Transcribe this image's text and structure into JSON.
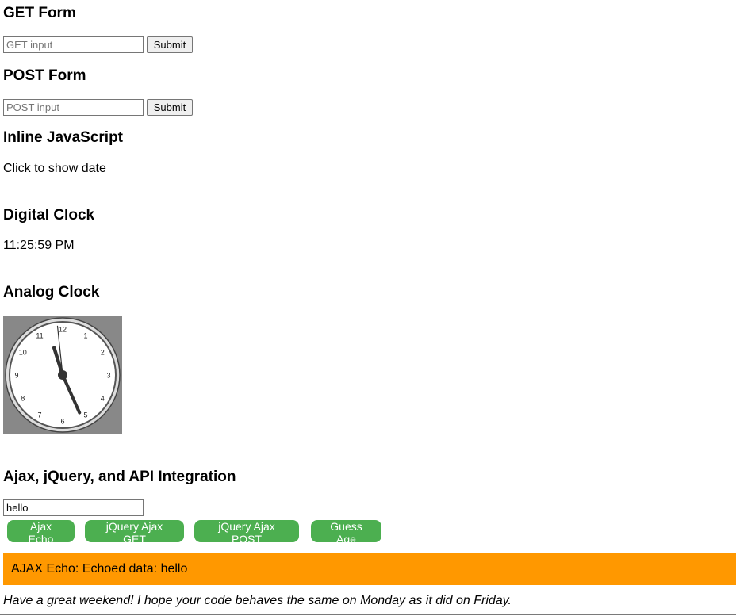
{
  "get_form": {
    "heading": "GET Form",
    "placeholder": "GET input",
    "submit_label": "Submit"
  },
  "post_form": {
    "heading": "POST Form",
    "placeholder": "POST input",
    "submit_label": "Submit"
  },
  "inline_js": {
    "heading": "Inline JavaScript",
    "text": "Click to show date"
  },
  "digital_clock": {
    "heading": "Digital Clock",
    "time": "11:25:59 PM"
  },
  "analog_clock": {
    "heading": "Analog Clock",
    "numbers": [
      "12",
      "1",
      "2",
      "3",
      "4",
      "5",
      "6",
      "7",
      "8",
      "9",
      "10",
      "11"
    ],
    "time": {
      "hours": 11,
      "minutes": 25,
      "seconds": 59
    },
    "colors": {
      "background": "#888888",
      "face": "#ffffff",
      "hands": "#333333"
    }
  },
  "ajax": {
    "heading": "Ajax, jQuery, and API Integration",
    "input_value": "hello",
    "buttons": [
      "Ajax Echo",
      "jQuery Ajax GET",
      "jQuery Ajax POST",
      "Guess Age"
    ],
    "result": "AJAX Echo: Echoed data: hello",
    "button_color": "#4caf50",
    "result_color": "#ff9800"
  },
  "footer": {
    "text": "Have a great weekend! I hope your code behaves the same on Monday as it did on Friday."
  }
}
